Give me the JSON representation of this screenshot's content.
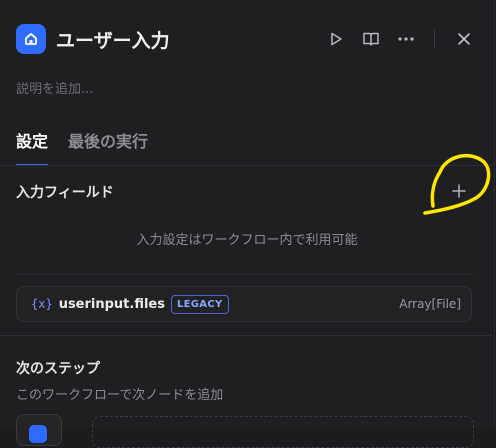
{
  "header": {
    "title": "ユーザー入力",
    "icons": [
      "home-icon",
      "play-icon",
      "book-icon",
      "more-icon",
      "close-icon"
    ]
  },
  "description_placeholder": "説明を追加...",
  "tabs": [
    {
      "label": "設定",
      "active": true
    },
    {
      "label": "最後の実行",
      "active": false
    }
  ],
  "input_fields": {
    "title": "入力フィールド",
    "empty_message": "入力設定はワークフロー内で利用可能",
    "variable": {
      "icon": "{x}",
      "name": "userinput.files",
      "badge": "LEGACY",
      "type": "Array[File]"
    }
  },
  "next_step": {
    "title": "次のステップ",
    "subtitle": "このワークフローで次ノードを追加"
  },
  "colors": {
    "accent": "#2f6bff",
    "annotation": "#ffe600"
  }
}
